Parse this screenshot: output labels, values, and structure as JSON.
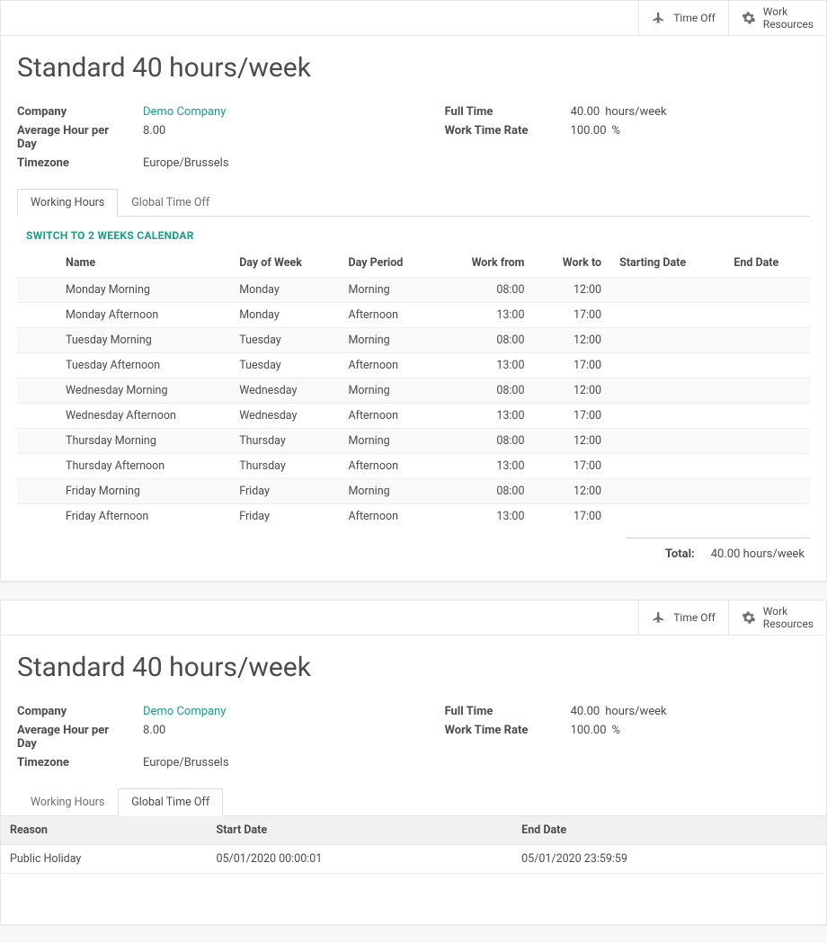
{
  "topbar": {
    "time_off": "Time Off",
    "work": "Work",
    "resources": "Resources"
  },
  "card1": {
    "title": "Standard 40 hours/week",
    "left": {
      "company_label": "Company",
      "company_value": "Demo Company",
      "avg_label": "Average Hour per Day",
      "avg_value": "8.00",
      "tz_label": "Timezone",
      "tz_value": "Europe/Brussels"
    },
    "right": {
      "fulltime_label": "Full Time",
      "fulltime_value": "40.00",
      "fulltime_unit": "hours/week",
      "rate_label": "Work Time Rate",
      "rate_value": "100.00",
      "rate_unit": "%"
    },
    "tabs": {
      "working_hours": "Working Hours",
      "global_time_off": "Global Time Off"
    },
    "switch_link": "SWITCH TO 2 WEEKS CALENDAR",
    "table": {
      "headers": {
        "name": "Name",
        "day_of_week": "Day of Week",
        "day_period": "Day Period",
        "work_from": "Work from",
        "work_to": "Work to",
        "starting_date": "Starting Date",
        "end_date": "End Date"
      },
      "rows": [
        {
          "name": "Monday Morning",
          "day": "Monday",
          "period": "Morning",
          "from": "08:00",
          "to": "12:00"
        },
        {
          "name": "Monday Afternoon",
          "day": "Monday",
          "period": "Afternoon",
          "from": "13:00",
          "to": "17:00"
        },
        {
          "name": "Tuesday Morning",
          "day": "Tuesday",
          "period": "Morning",
          "from": "08:00",
          "to": "12:00"
        },
        {
          "name": "Tuesday Afternoon",
          "day": "Tuesday",
          "period": "Afternoon",
          "from": "13:00",
          "to": "17:00"
        },
        {
          "name": "Wednesday Morning",
          "day": "Wednesday",
          "period": "Morning",
          "from": "08:00",
          "to": "12:00"
        },
        {
          "name": "Wednesday Afternoon",
          "day": "Wednesday",
          "period": "Afternoon",
          "from": "13:00",
          "to": "17:00"
        },
        {
          "name": "Thursday Morning",
          "day": "Thursday",
          "period": "Morning",
          "from": "08:00",
          "to": "12:00"
        },
        {
          "name": "Thursday Afternoon",
          "day": "Thursday",
          "period": "Afternoon",
          "from": "13:00",
          "to": "17:00"
        },
        {
          "name": "Friday Morning",
          "day": "Friday",
          "period": "Morning",
          "from": "08:00",
          "to": "12:00"
        },
        {
          "name": "Friday Afternoon",
          "day": "Friday",
          "period": "Afternoon",
          "from": "13:00",
          "to": "17:00"
        }
      ]
    },
    "total": {
      "label": "Total:",
      "value": "40.00",
      "unit": "hours/week"
    }
  },
  "card2": {
    "title": "Standard 40 hours/week",
    "left": {
      "company_label": "Company",
      "company_value": "Demo Company",
      "avg_label": "Average Hour per Day",
      "avg_value": "8.00",
      "tz_label": "Timezone",
      "tz_value": "Europe/Brussels"
    },
    "right": {
      "fulltime_label": "Full Time",
      "fulltime_value": "40.00",
      "fulltime_unit": "hours/week",
      "rate_label": "Work Time Rate",
      "rate_value": "100.00",
      "rate_unit": "%"
    },
    "tabs": {
      "working_hours": "Working Hours",
      "global_time_off": "Global Time Off"
    },
    "gto": {
      "headers": {
        "reason": "Reason",
        "start_date": "Start Date",
        "end_date": "End Date"
      },
      "rows": [
        {
          "reason": "Public Holiday",
          "start": "05/01/2020 00:00:01",
          "end": "05/01/2020 23:59:59"
        }
      ]
    }
  }
}
